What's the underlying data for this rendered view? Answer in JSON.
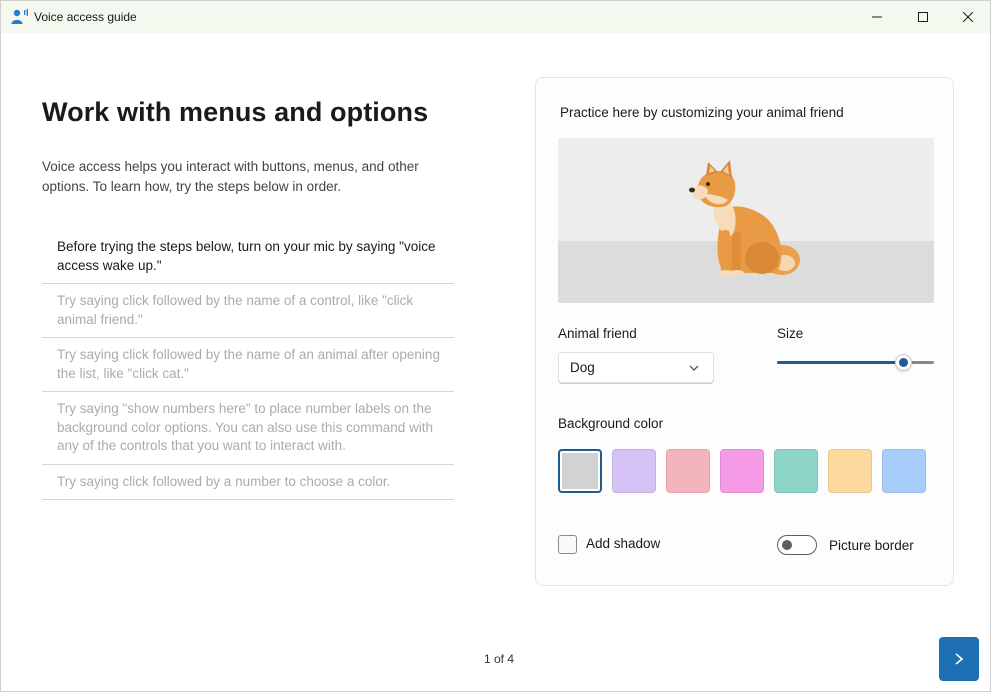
{
  "window": {
    "title": "Voice access guide",
    "icons": {
      "app": "voice-access-person-icon",
      "minimize": "minimize-icon",
      "maximize": "maximize-icon",
      "close": "close-icon"
    }
  },
  "left": {
    "heading": "Work with menus and options",
    "intro": "Voice access helps you interact with buttons, menus, and other options. To learn how, try the steps below in order.",
    "steps": [
      {
        "text": "Before trying the steps below, turn on your mic by saying \"voice access wake up.\"",
        "active": true
      },
      {
        "text": "Try saying click followed by the name of a control, like \"click animal friend.\"",
        "active": false
      },
      {
        "text": "Try saying click followed by the name of an animal after opening the list, like \"click cat.\"",
        "active": false
      },
      {
        "text": "Try saying \"show numbers here\" to place number labels on the background color options. You can also use this command with any of the controls that you want to interact with.",
        "active": false
      },
      {
        "text": "Try saying click followed by a number to choose a color.",
        "active": false
      }
    ]
  },
  "practice": {
    "title": "Practice here by customizing your animal friend",
    "preview_icon": "shiba-dog-illustration",
    "animal_label": "Animal friend",
    "animal_value": "Dog",
    "size_label": "Size",
    "size_value": 0.8,
    "bg_label": "Background color",
    "colors": [
      "#d2d2d2",
      "#d5c3f5",
      "#f4b4bc",
      "#f59be6",
      "#8dd5c6",
      "#fcd99d",
      "#a9cdfb"
    ],
    "selected_color": 0,
    "shadow_label": "Add shadow",
    "shadow_checked": false,
    "border_label": "Picture border",
    "border_on": false,
    "accent": "#1f5c91"
  },
  "footer": {
    "pager": "1 of 4",
    "next_icon": "chevron-right-icon"
  }
}
